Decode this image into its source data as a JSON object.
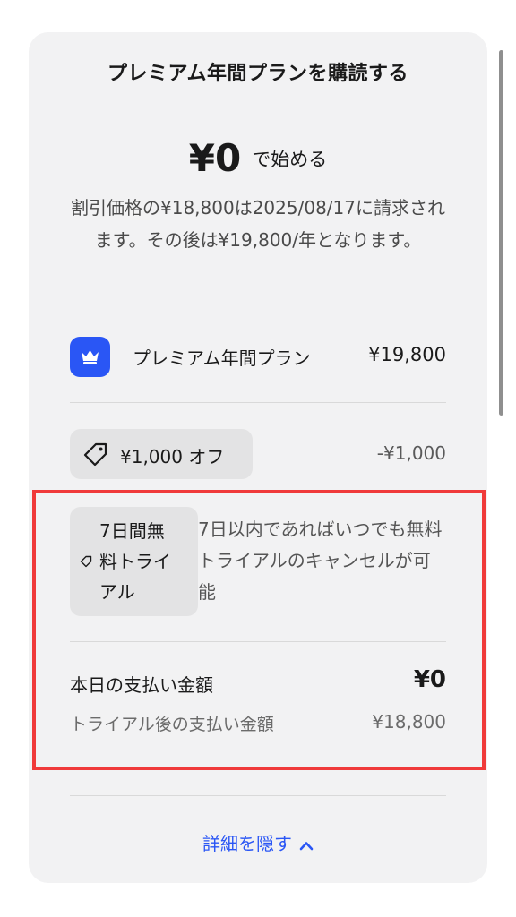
{
  "title": "プレミアム年間プランを購読する",
  "price": {
    "amount": "¥0",
    "suffix": "で始める"
  },
  "description": "割引価格の¥18,800は2025/08/17に請求されます。その後は¥19,800/年となります。",
  "plan": {
    "icon": "crown-icon",
    "name": "プレミアム年間プラン",
    "price": "¥19,800"
  },
  "coupon": {
    "icon": "tag-icon",
    "label": "¥1,000 オフ",
    "discount": "-¥1,000"
  },
  "trial": {
    "icon": "tag-icon",
    "badge": "7日間無料トライアル",
    "description": "7日以内であればいつでも無料トライアルのキャンセルが可能"
  },
  "payment": {
    "today_label": "本日の支払い金額",
    "today_amount": "¥0",
    "after_trial_label": "トライアル後の支払い金額",
    "after_trial_amount": "¥18,800"
  },
  "hide_details": {
    "label": "詳細を隠す",
    "icon": "chevron-up-icon"
  },
  "colors": {
    "accent": "#2a56f5",
    "highlight": "#f03a3a",
    "card_background": "#f2f2f3"
  }
}
